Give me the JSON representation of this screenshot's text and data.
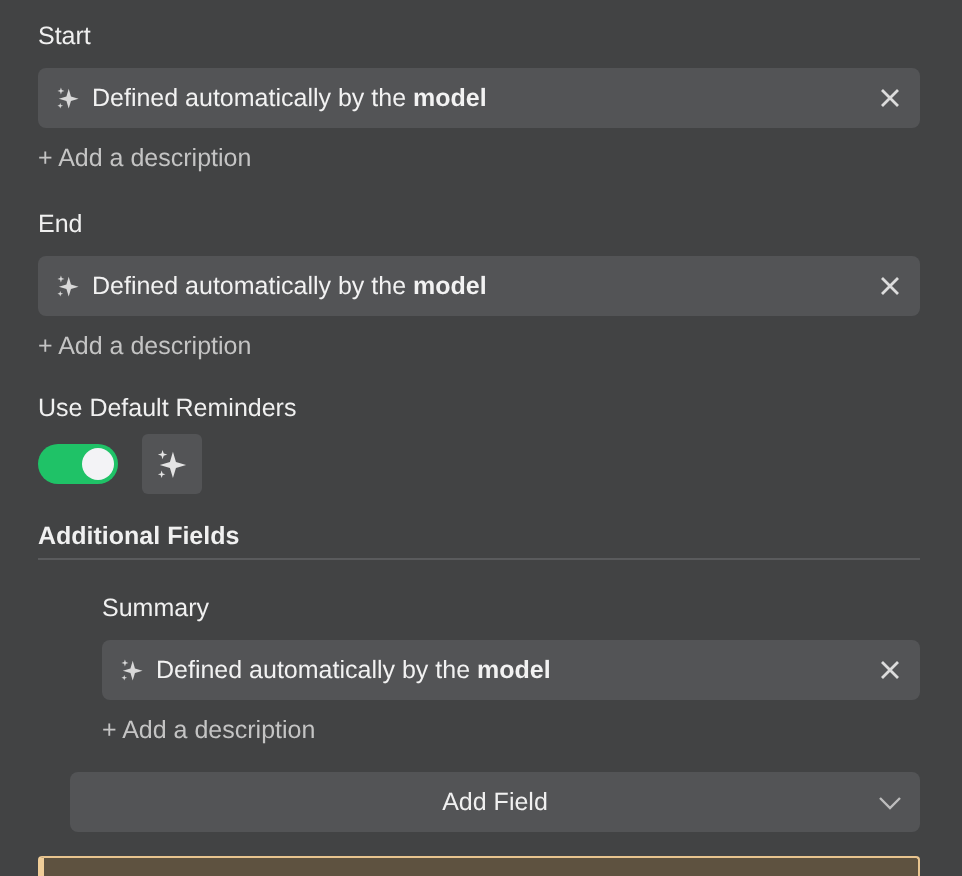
{
  "fields": [
    {
      "label": "Start",
      "value": "Defined automatically by the **model**",
      "add_description": "+ Add a description"
    },
    {
      "label": "End",
      "value": "Defined automatically by the **model**",
      "add_description": "+ Add a description"
    }
  ],
  "reminders": {
    "label": "Use Default Reminders",
    "on": true
  },
  "additional_fields": {
    "title": "Additional Fields",
    "fields": [
      {
        "label": "Summary",
        "value": "Defined automatically by the **model**",
        "add_description": "+ Add a description"
      }
    ],
    "add_button": "Add Field"
  }
}
